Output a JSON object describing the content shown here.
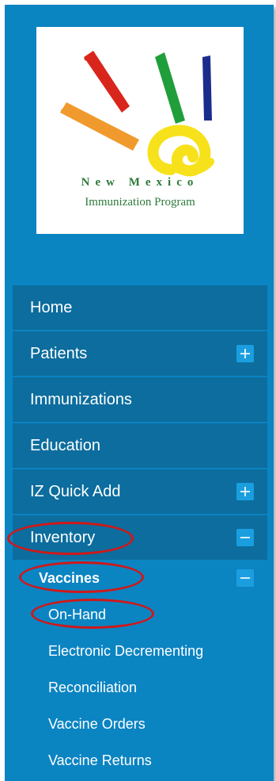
{
  "logo": {
    "line1": "New Mexico",
    "line2": "Immunization Program",
    "colors": {
      "red": "#d9261c",
      "orange": "#f09a2e",
      "green": "#1f9e3a",
      "blue": "#1b2d8c",
      "yellow": "#f7e11b"
    }
  },
  "menu": {
    "items": [
      {
        "label": "Home",
        "toggle": null
      },
      {
        "label": "Patients",
        "toggle": "expand-icon"
      },
      {
        "label": "Immunizations",
        "toggle": null
      },
      {
        "label": "Education",
        "toggle": null
      },
      {
        "label": "IZ Quick Add",
        "toggle": "expand-icon"
      },
      {
        "label": "Inventory",
        "toggle": "collapse-icon"
      }
    ],
    "inventory": {
      "vaccines_label": "Vaccines",
      "vaccines_toggle": "collapse-icon",
      "vaccine_items": [
        {
          "label": "On-Hand"
        },
        {
          "label": "Electronic Decrementing"
        },
        {
          "label": "Reconciliation"
        },
        {
          "label": "Vaccine Orders"
        },
        {
          "label": "Vaccine Returns"
        }
      ]
    }
  },
  "annotations": {
    "ring_color": "#d01818",
    "circled_items": [
      "Inventory",
      "Vaccines",
      "On-Hand"
    ]
  },
  "theme": {
    "sidebar_bg": "#0b84c2",
    "item_bg": "#0c6d9e",
    "toggle_bg": "#1b9ee0",
    "text": "#ffffff"
  }
}
